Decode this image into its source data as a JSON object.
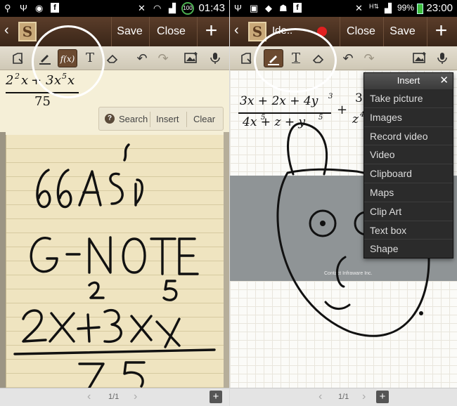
{
  "left": {
    "status": {
      "time": "01:43",
      "battery": "100"
    },
    "actionbar": {
      "save_label": "Save",
      "close_label": "Close",
      "new_label": "+",
      "logo": "S"
    },
    "formula": {
      "num_a": "2",
      "exp_a": "2",
      "plus": "+",
      "num_b": "3",
      "exp_b": "5",
      "den": "75"
    },
    "search": {
      "label": "Search",
      "insert": "Insert",
      "clear": "Clear"
    },
    "handwriting": {
      "line1": "66Aś",
      "line2": "G-NOTE",
      "line3": "2X+3XX",
      "line4": "75",
      "sup1": "2",
      "sup2": "5"
    },
    "footer": {
      "page": "1/1",
      "add": "+"
    }
  },
  "right": {
    "status": {
      "time": "23:00",
      "battery": "99%"
    },
    "actionbar": {
      "title": "Ide..",
      "close_label": "Close",
      "save_label": "Save",
      "new_label": "+",
      "logo": "S"
    },
    "formula": {
      "num": "3x + 2x + 4y",
      "num_exp": "3",
      "den": "4x + z + y",
      "den_exp1": "5",
      "den_exp2": "5",
      "plus": "+",
      "trail": "3",
      "trail_den": "z",
      "trail_exp": "4"
    },
    "insert_menu": {
      "title": "Insert",
      "close": "✕",
      "items": [
        "Take picture",
        "Images",
        "Record video",
        "Video",
        "Clipboard",
        "Maps",
        "Clip Art",
        "Text box",
        "Shape"
      ]
    },
    "image_caption": "Contact Infraware Inc.",
    "footer": {
      "page": "1/1",
      "add": "+"
    }
  },
  "colors": {
    "actionbar": "#4a3120",
    "accent_tool": "#6b4a30",
    "menu": "#2b2b2b",
    "note_paper": "#efe4c0"
  }
}
